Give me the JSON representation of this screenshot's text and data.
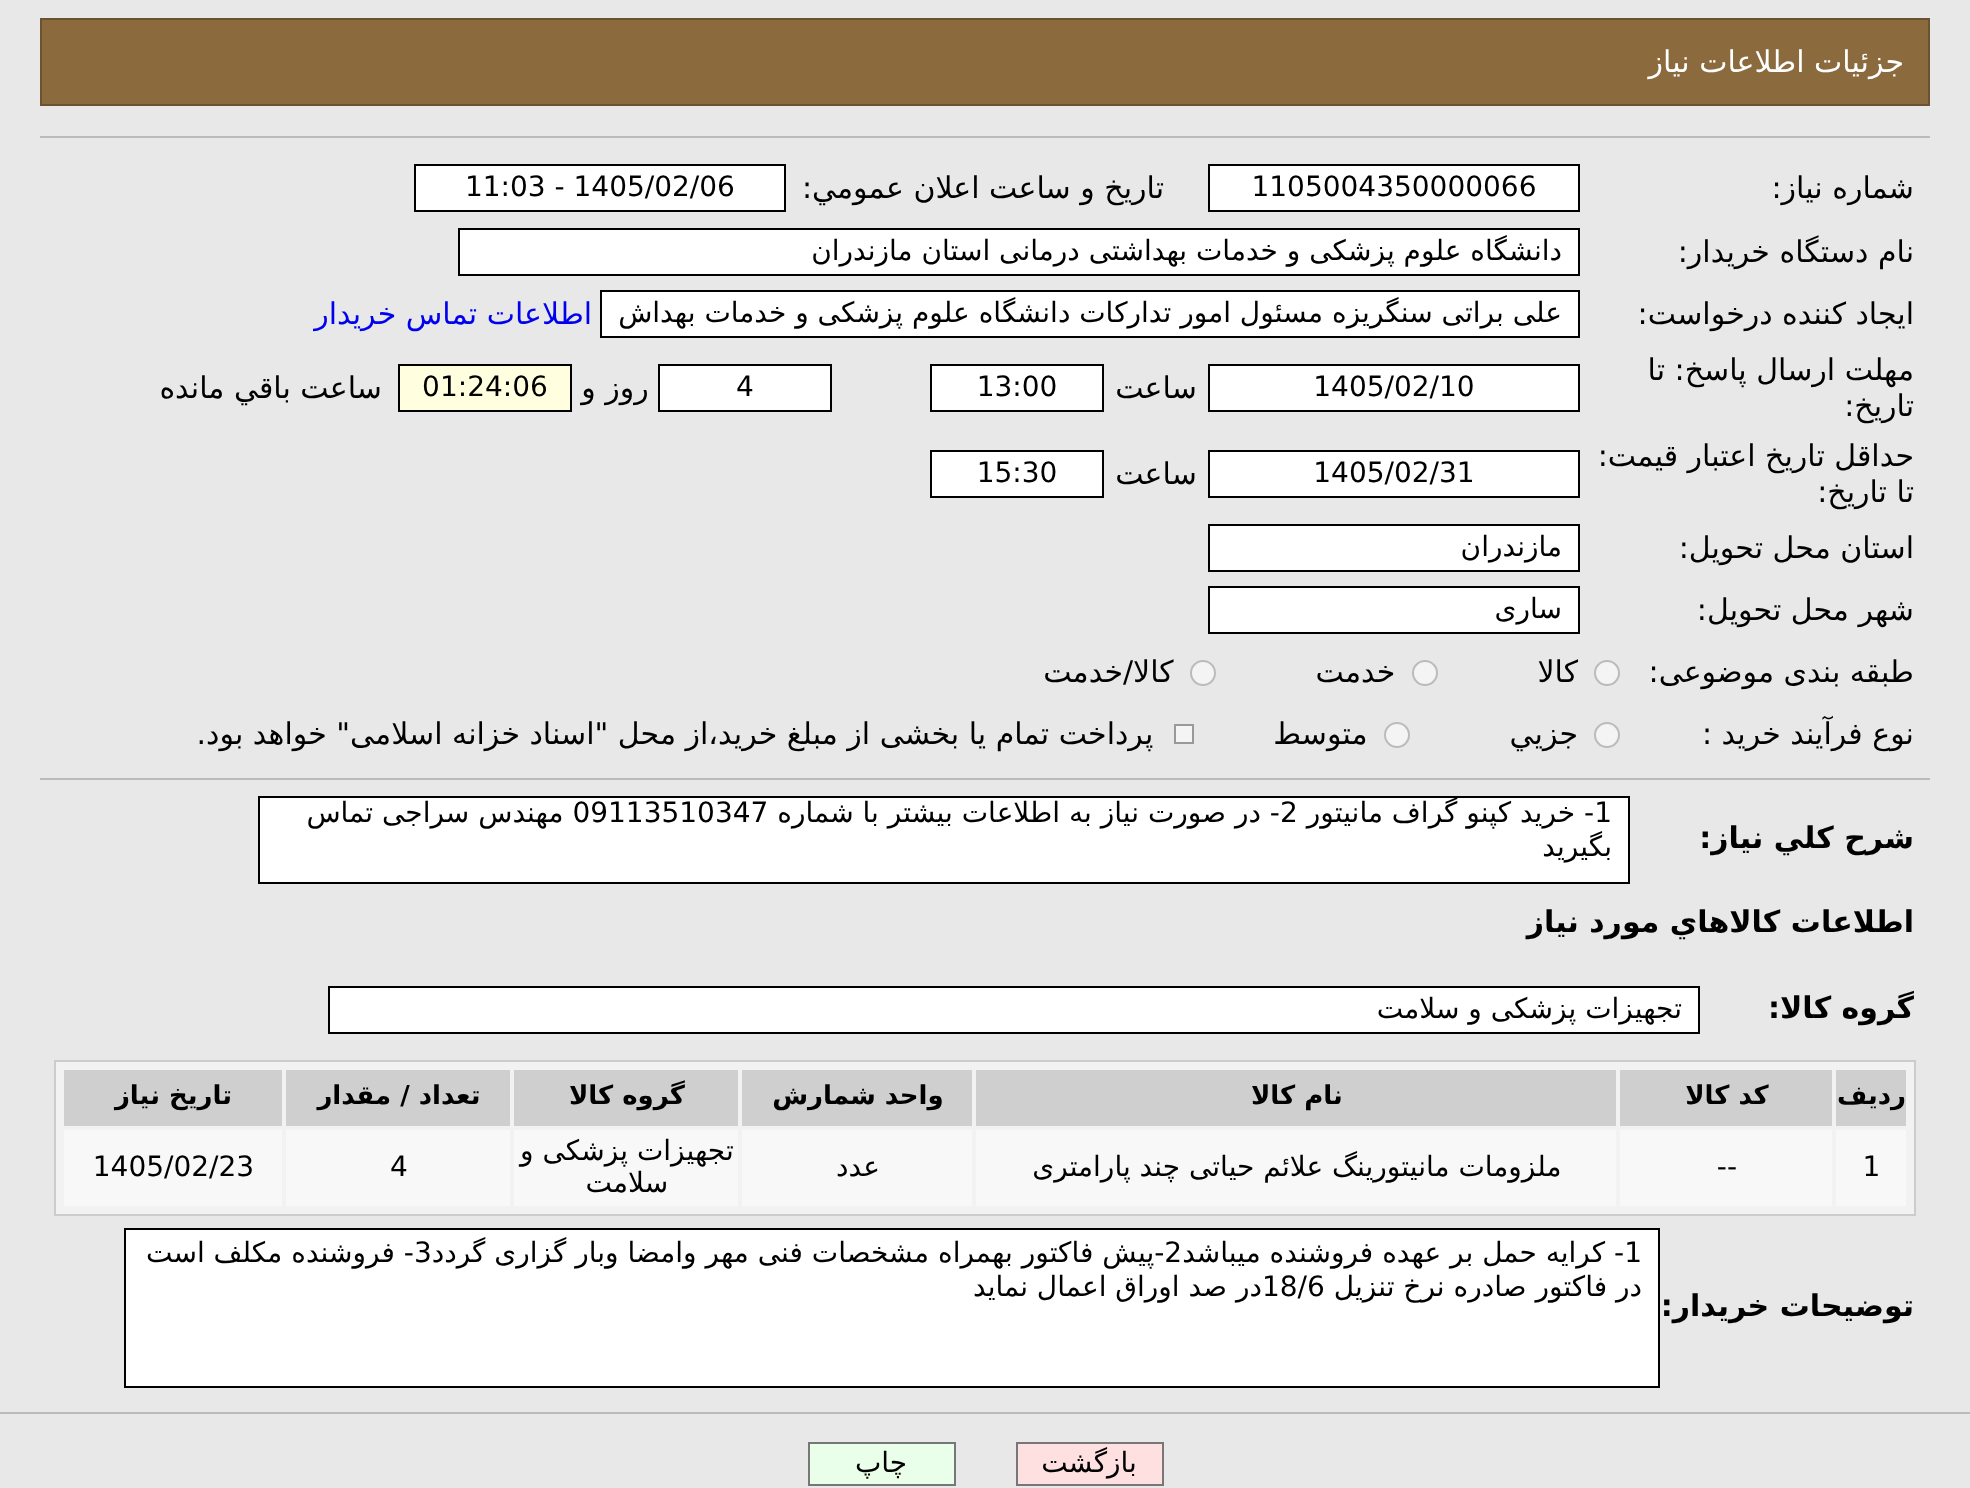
{
  "header": {
    "title": "جزئیات اطلاعات نیاز"
  },
  "need_number": {
    "label": "شماره نیاز:",
    "value": "1105004350000066"
  },
  "announce": {
    "label": "تاریخ و ساعت اعلان عمومي:",
    "value": "1405/02/06 - 11:03"
  },
  "buyer": {
    "label": "نام دستگاه خریدار:",
    "value": "دانشگاه علوم پزشکی و خدمات بهداشتی  درمانی استان مازندران"
  },
  "creator": {
    "label": "ایجاد کننده درخواست:",
    "value": "علی براتی سنگریزه مسئول امور تدارکات دانشگاه علوم پزشکی و خدمات بهداش",
    "link": "اطلاعات تماس خریدار"
  },
  "deadline": {
    "label": "مهلت ارسال پاسخ: تا تاریخ:",
    "date": "1405/02/10",
    "time_label": "ساعت",
    "time": "13:00",
    "days": "4",
    "days_label": "روز و",
    "remaining": "01:24:06",
    "remaining_label": "ساعت باقي مانده"
  },
  "validity": {
    "label": "حداقل تاریخ اعتبار قیمت: تا تاریخ:",
    "date": "1405/02/31",
    "time_label": "ساعت",
    "time": "15:30"
  },
  "province": {
    "label": "استان محل تحویل:",
    "value": "مازندران"
  },
  "city": {
    "label": "شهر محل تحویل:",
    "value": "ساری"
  },
  "category": {
    "label": "طبقه بندی موضوعی:",
    "options": [
      {
        "label": "کالا",
        "selected": false
      },
      {
        "label": "خدمت",
        "selected": false
      },
      {
        "label": "کالا/خدمت",
        "selected": false
      }
    ]
  },
  "purchase_type": {
    "label": "نوع فرآیند خرید :",
    "options": [
      {
        "label": "جزيي",
        "selected": false
      },
      {
        "label": "متوسط",
        "selected": false
      }
    ],
    "note_checked": false,
    "note": "پرداخت تمام یا بخشی از مبلغ خرید،از محل \"اسناد خزانه اسلامی\" خواهد بود."
  },
  "description": {
    "label": "شرح کلي نیاز:",
    "value": "1- خرید کپنو گراف مانیتور 2- در صورت نیاز به اطلاعات بیشتر با شماره 09113510347 مهندس سراجی تماس بگیرید"
  },
  "goods_title": "اطلاعات کالاهاي مورد نیاز",
  "goods_group": {
    "label": "گروه کالا:",
    "value": "تجهیزات پزشکی و سلامت"
  },
  "table": {
    "columns": [
      "ردیف",
      "کد کالا",
      "نام کالا",
      "واحد شمارش",
      "گروه کالا",
      "تعداد / مقدار",
      "تاریخ نیاز"
    ],
    "rows": [
      [
        "1",
        "--",
        "ملزومات مانیتورینگ علائم حیاتی چند پارامتری",
        "عدد",
        "تجهیزات پزشکی و سلامت",
        "4",
        "1405/02/23"
      ]
    ]
  },
  "buyer_notes": {
    "label": "توضیحات خریدار:",
    "value": "1- کرایه حمل بر عهده فروشنده میباشد2-پیش فاکتور بهمراه مشخصات فنی مهر وامضا وبار گزاری گردد3- فروشنده مکلف است در فاکتور صادره نرخ تنزیل 18/6در صد اوراق اعمال نماید"
  },
  "buttons": [
    {
      "label": "بازگشت",
      "kind": "back"
    },
    {
      "label": "چاپ",
      "kind": "print"
    }
  ]
}
